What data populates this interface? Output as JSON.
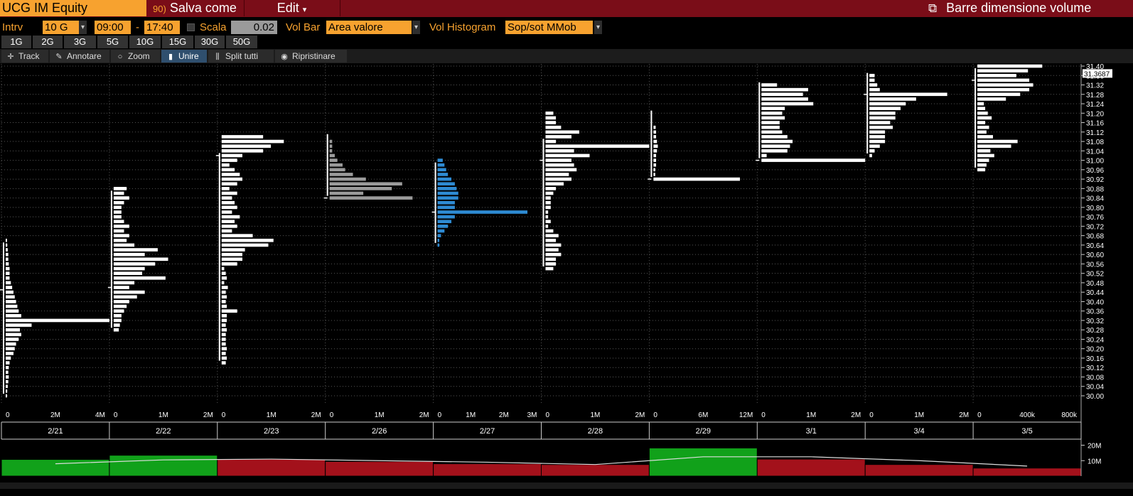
{
  "header": {
    "ticker": "UCG IM Equity",
    "save_icon": "90)",
    "save_label": "Salva come",
    "edit_label": "Edit",
    "edit_arrow": "▾",
    "right_icon": "⧉",
    "right_label": "Barre dimensione volume"
  },
  "controls": {
    "interval_label": "Intrv",
    "interval_value": "10 G",
    "start_time": "09:00",
    "dash": "-",
    "end_time": "17:40",
    "scale_label": "Scala",
    "scale_value": "0.02",
    "volbar_label": "Vol Bar",
    "volbar_value": "Area valore",
    "volhist_label": "Vol Histogram",
    "volhist_value": "Sop/sot MMob",
    "dd_arrow": "▾"
  },
  "periods": [
    "1G",
    "2G",
    "3G",
    "5G",
    "10G",
    "15G",
    "30G",
    "50G"
  ],
  "tools": {
    "track": "Track",
    "annotate": "Annotare",
    "zoom": "Zoom",
    "merge": "Unire",
    "split": "Split tutti",
    "reset": "Ripristinare"
  },
  "colors": {
    "bar": "#ffffff",
    "gray_bar": "#9b9b9b",
    "blue_bar": "#2e8bd3",
    "up": "#11a11a",
    "down": "#a3111b"
  },
  "chart_data": {
    "type": "bar",
    "orientation": "horizontal volume profile",
    "price_axis": {
      "min": 30.0,
      "max": 31.4,
      "step": 0.04,
      "labels": [
        "31.40",
        "31.36",
        "31.32",
        "31.28",
        "31.24",
        "31.20",
        "31.16",
        "31.12",
        "31.08",
        "31.04",
        "31.00",
        "30.96",
        "30.92",
        "30.88",
        "30.84",
        "30.80",
        "30.76",
        "30.72",
        "30.68",
        "30.64",
        "30.60",
        "30.56",
        "30.52",
        "30.48",
        "30.44",
        "30.40",
        "30.36",
        "30.32",
        "30.28",
        "30.24",
        "30.20",
        "30.16",
        "30.12",
        "30.08",
        "30.04",
        "30.00"
      ],
      "last_price": "31.3687"
    },
    "sessions": [
      {
        "date": "2/21",
        "scale": [
          "0",
          "2M",
          "4M"
        ],
        "max": 4,
        "style": "white",
        "range": [
          30.0,
          30.66
        ],
        "poc": 30.45,
        "values": [
          0.05,
          0.06,
          0.08,
          0.1,
          0.12,
          0.1,
          0.12,
          0.15,
          0.2,
          0.3,
          0.35,
          0.4,
          0.5,
          0.6,
          0.55,
          1.0,
          4.0,
          0.6,
          0.5,
          0.45,
          0.4,
          0.35,
          0.3,
          0.25,
          0.2,
          0.15,
          0.15,
          0.15,
          0.12,
          0.1,
          0.1,
          0.08,
          0.06,
          0.05
        ]
      },
      {
        "date": "2/22",
        "scale": [
          "0",
          "1M",
          "2M"
        ],
        "max": 2,
        "style": "white",
        "range": [
          30.28,
          30.88
        ],
        "poc": 30.46,
        "values": [
          0.1,
          0.12,
          0.15,
          0.15,
          0.2,
          0.25,
          0.3,
          0.45,
          0.6,
          0.3,
          0.4,
          1.0,
          0.55,
          0.6,
          0.8,
          1.05,
          0.6,
          0.85,
          0.4,
          0.25,
          0.3,
          0.2,
          0.3,
          0.2,
          0.15,
          0.15,
          0.15,
          0.2,
          0.3,
          0.2,
          0.25
        ]
      },
      {
        "date": "2/23",
        "scale": [
          "0",
          "1M",
          "2M"
        ],
        "max": 2,
        "style": "white",
        "range": [
          30.14,
          31.04
        ],
        "poc": 31.02,
        "values": [
          0.08,
          0.1,
          0.08,
          0.1,
          0.08,
          0.08,
          0.08,
          0.1,
          0.08,
          0.1,
          0.1,
          0.3,
          0.1,
          0.08,
          0.1,
          0.08,
          0.12,
          0.05,
          0.1,
          0.08,
          0.05,
          0.3,
          0.4,
          0.4,
          0.45,
          0.9,
          1.0,
          0.6,
          0.2,
          0.3,
          0.25,
          0.35,
          0.2,
          0.3,
          0.25,
          0.2,
          0.3,
          0.15,
          0.3,
          0.4,
          0.35,
          0.25,
          0.15,
          0.3,
          0.4,
          0.8,
          0.95,
          1.2,
          0.8
        ]
      },
      {
        "date": "2/26",
        "scale": [
          "0",
          "1M",
          "2M"
        ],
        "max": 2,
        "style": "gray",
        "range": [
          30.84,
          31.12
        ],
        "poc": 30.84,
        "values": [
          1.6,
          0.65,
          1.2,
          1.4,
          0.7,
          0.45,
          0.3,
          0.25,
          0.15,
          0.1,
          0.05,
          0.05,
          0.05
        ]
      },
      {
        "date": "2/27",
        "scale": [
          "0",
          "1M",
          "2M",
          "3M"
        ],
        "max": 3,
        "style": "blue",
        "range": [
          30.64,
          31.0
        ],
        "poc": 30.78,
        "values": [
          0.05,
          0.05,
          0.1,
          0.2,
          0.3,
          0.4,
          0.5,
          2.6,
          0.5,
          0.5,
          0.6,
          0.6,
          0.55,
          0.5,
          0.4,
          0.3,
          0.25,
          0.2,
          0.15
        ]
      },
      {
        "date": "2/28",
        "scale": [
          "0",
          "1M",
          "2M"
        ],
        "max": 2,
        "style": "white",
        "range": [
          30.54,
          31.1
        ],
        "poc": 31.0,
        "values": [
          0.15,
          0.2,
          0.2,
          0.3,
          0.25,
          0.3,
          0.2,
          0.25,
          0.15,
          0.05,
          0.1,
          0.05,
          0.05,
          0.1,
          0.1,
          0.1,
          0.15,
          0.2,
          0.35,
          0.5,
          0.45,
          0.6,
          0.55,
          0.5,
          0.85,
          0.55,
          2.0,
          0.2,
          0.5,
          0.65,
          0.3,
          0.2,
          0.2,
          0.15
        ]
      },
      {
        "date": "2/29",
        "scale": [
          "0",
          "6M",
          "12M"
        ],
        "max": 12,
        "style": "white",
        "range": [
          30.92,
          31.22
        ],
        "poc": 30.92,
        "values": [
          10.0,
          0.2,
          0.2,
          0.3,
          0.3,
          0.3,
          0.4,
          0.5,
          0.4,
          0.3,
          0.3,
          0.25
        ]
      },
      {
        "date": "3/1",
        "scale": [
          "0",
          "1M",
          "2M"
        ],
        "max": 2,
        "style": "white",
        "range": [
          31.0,
          31.34
        ],
        "poc": 31.0,
        "values": [
          2.0,
          0.1,
          0.5,
          0.55,
          0.6,
          0.5,
          0.4,
          0.35,
          0.35,
          0.45,
          0.4,
          0.45,
          1.0,
          0.9,
          0.8,
          0.9,
          0.3
        ]
      },
      {
        "date": "3/4",
        "scale": [
          "0",
          "1M",
          "2M"
        ],
        "max": 2,
        "style": "white",
        "range": [
          31.02,
          31.38
        ],
        "poc": 31.28,
        "values": [
          0.05,
          0.1,
          0.2,
          0.3,
          0.3,
          0.3,
          0.45,
          0.4,
          0.5,
          0.5,
          0.6,
          0.7,
          0.9,
          1.5,
          0.2,
          0.15,
          0.1,
          0.1
        ]
      },
      {
        "date": "3/5",
        "scale": [
          "0",
          "400k",
          "800k"
        ],
        "max": 800,
        "style": "white",
        "range": [
          30.96,
          31.4
        ],
        "poc": 31.34,
        "values": [
          60,
          70,
          90,
          130,
          100,
          260,
          310,
          120,
          70,
          90,
          60,
          110,
          80,
          60,
          50,
          220,
          330,
          400,
          430,
          400,
          300,
          390,
          500,
          100
        ]
      }
    ],
    "volume": {
      "axis_labels": [
        "20M",
        "10M"
      ],
      "sessions": [
        {
          "date": "2/21",
          "volume": 10.8,
          "dir": "up",
          "avg": 8.0
        },
        {
          "date": "2/22",
          "volume": 13.5,
          "dir": "up",
          "avg": 10.5
        },
        {
          "date": "2/23",
          "volume": 11.0,
          "dir": "down",
          "avg": 11.0
        },
        {
          "date": "2/26",
          "volume": 9.5,
          "dir": "down",
          "avg": 10.0
        },
        {
          "date": "2/27",
          "volume": 8.0,
          "dir": "down",
          "avg": 9.0
        },
        {
          "date": "2/28",
          "volume": 7.5,
          "dir": "down",
          "avg": 7.5
        },
        {
          "date": "2/29",
          "volume": 18.2,
          "dir": "up",
          "avg": 12.5
        },
        {
          "date": "3/1",
          "volume": 11.0,
          "dir": "down",
          "avg": 12.5
        },
        {
          "date": "3/4",
          "volume": 7.5,
          "dir": "down",
          "avg": 10.0
        },
        {
          "date": "3/5",
          "volume": 5.2,
          "dir": "down",
          "avg": 6.5
        }
      ]
    }
  }
}
